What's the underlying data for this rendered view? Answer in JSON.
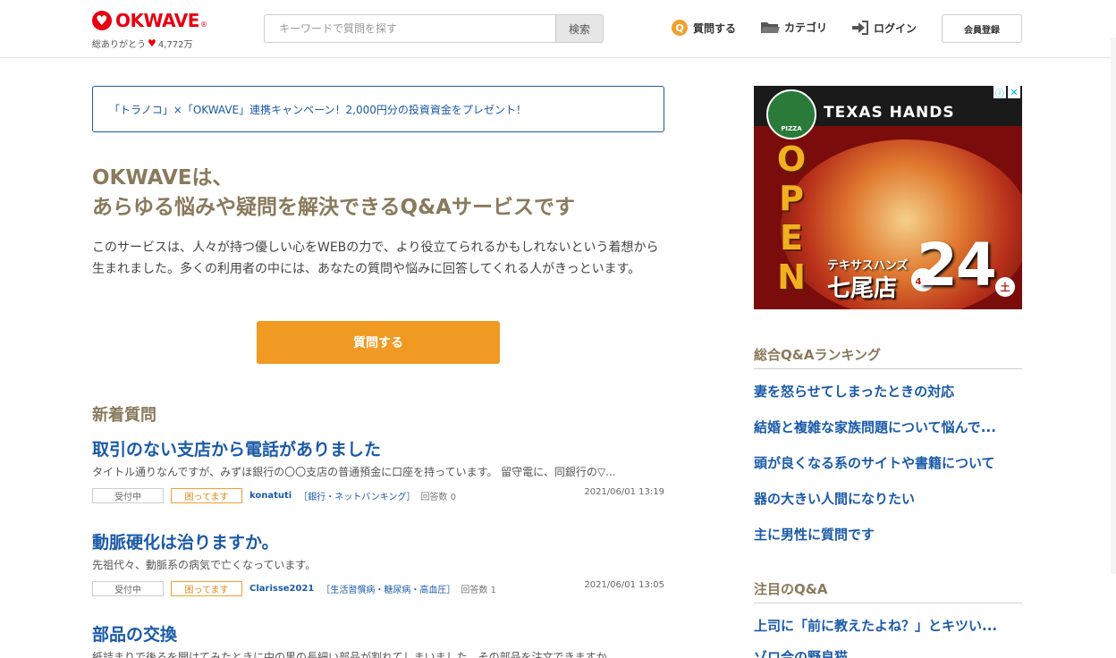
{
  "header": {
    "logo_text": "OKWAVE",
    "logo_reg": "®",
    "thanks_label": "総ありがとう",
    "thanks_count": "4,772万",
    "search_placeholder": "キーワードで質問を探す",
    "search_button": "検索",
    "nav_ask": "質問する",
    "nav_category": "カテゴリ",
    "nav_login": "ログイン",
    "register_button": "会員登録"
  },
  "campaign": {
    "text": "「トラノコ」×「OKWAVE」連携キャンペーン！2,000円分の投資資金をプレゼント！"
  },
  "intro": {
    "title_line1": "OKWAVEは、",
    "title_line2": "あらゆる悩みや疑問を解決できるQ&Aサービスです",
    "text": "このサービスは、人々が持つ優しい心をWEBの力で、より役立てられるかもしれないという着想から生まれました。多くの利用者の中には、あなたの質問や悩みに回答してくれる人がきっといます。",
    "ask_button": "質問する"
  },
  "new_questions": {
    "heading": "新着質問",
    "items": [
      {
        "title": "取引のない支店から電話がありました",
        "excerpt": "タイトル通りなんですが、みずほ銀行の〇〇支店の普通預金に口座を持っています。 留守電に、同銀行の▽...",
        "status": "受付中",
        "tag": "困ってます",
        "user": "konatuti",
        "category": "［銀行・ネットバンキング］",
        "answers": "回答数 0",
        "date": "2021/06/01 13:19"
      },
      {
        "title": "動脈硬化は治りますか。",
        "excerpt": "先祖代々、動脈系の病気で亡くなっています。",
        "status": "受付中",
        "tag": "困ってます",
        "user": "Clarisse2021",
        "category": "［生活習慣病・糖尿病・高血圧］",
        "answers": "回答数 1",
        "date": "2021/06/01 13:05"
      },
      {
        "title": "部品の交換",
        "excerpt": "紙詰まりで後ろを開けてみたときに中の黒の長細い部品が割れてしまいました。その部品を注文できますか"
      }
    ]
  },
  "ad": {
    "brand": "TEXAS HANDS",
    "logo_label": "PIZZA",
    "open_text": [
      "O",
      "P",
      "E",
      "N"
    ],
    "jp_brand": "テキサスハンズ",
    "store": "七尾店",
    "month": "4月",
    "date": "24",
    "weekday": "土",
    "info_icon": "ⓘ",
    "close_icon": "✕"
  },
  "sidebar": {
    "ranking_heading": "総合Q&Aランキング",
    "ranking_items": [
      "妻を怒らせてしまったときの対応",
      "結婚と複雑な家族問題について悩んで...",
      "頭が良くなる系のサイトや書籍について",
      "器の大きい人間になりたい",
      "主に男性に質問です"
    ],
    "featured_heading": "注目のQ&A",
    "featured_items": [
      "上司に「前に教えたよね？」とキツい...",
      "ゾロ合の野良猫"
    ]
  },
  "colors": {
    "brand_red": "#e60012",
    "link_blue": "#1a5aa8",
    "heading_brown": "#8a7a5c",
    "accent_orange": "#f09a23"
  }
}
